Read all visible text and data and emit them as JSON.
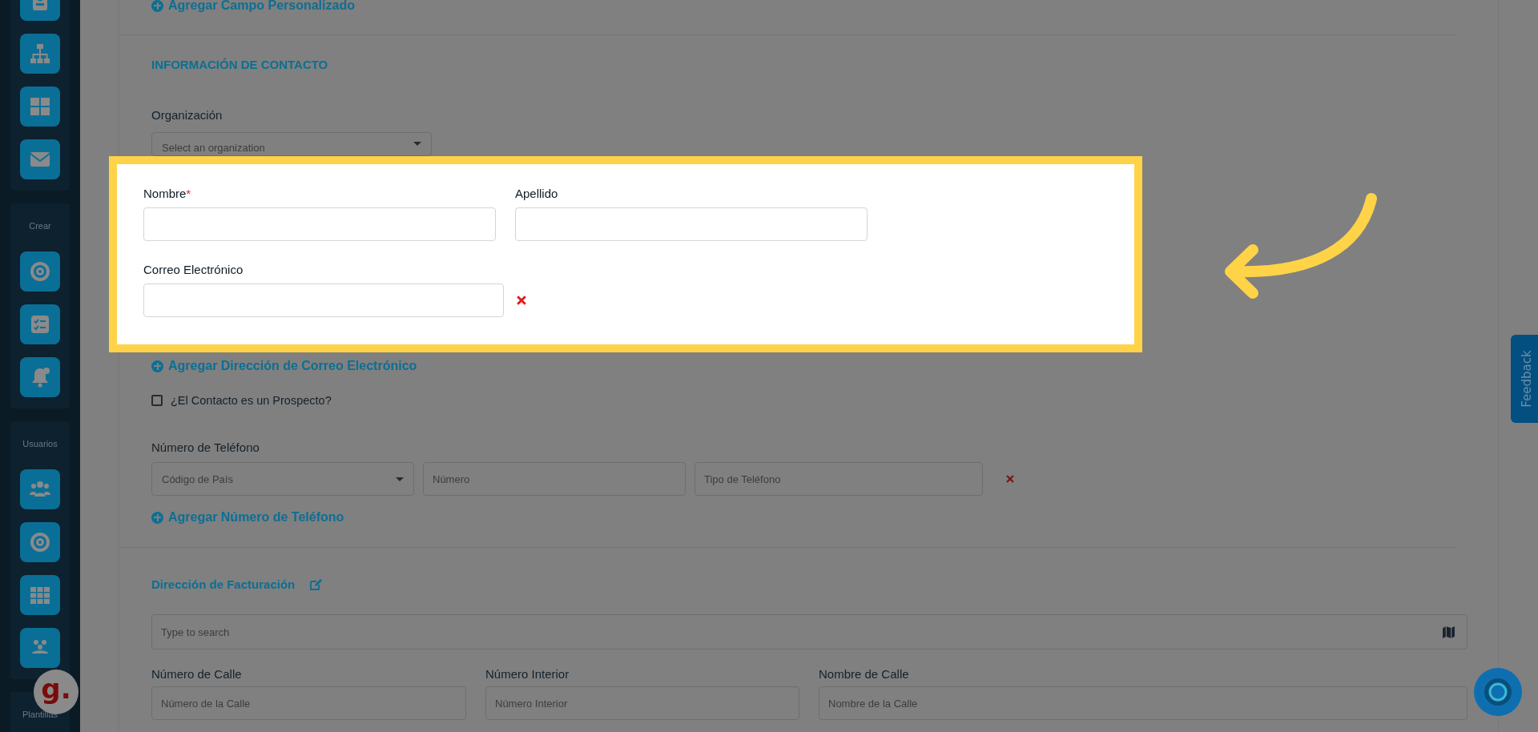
{
  "sidebar": {
    "groups": [
      {
        "items": [
          {
            "kind": "contact"
          },
          {
            "kind": "org-chart"
          },
          {
            "kind": "dashboard"
          },
          {
            "kind": "mail"
          }
        ]
      },
      {
        "label": "Crear",
        "items": [
          {
            "kind": "target"
          },
          {
            "kind": "checklist"
          },
          {
            "kind": "reminder"
          }
        ]
      },
      {
        "label": "Usuarios",
        "items": [
          {
            "kind": "team"
          },
          {
            "kind": "goal"
          },
          {
            "kind": "apps"
          },
          {
            "kind": "groups"
          }
        ]
      },
      {
        "label": "Plantillas"
      }
    ],
    "logo": "g."
  },
  "form": {
    "custom_field_link": "Agregar Campo Personalizado",
    "section_title": "INFORMACIÓN DE CONTACTO",
    "organization": {
      "label": "Organización",
      "placeholder": "Select an organization"
    },
    "highlight": {
      "first_name": {
        "label": "Nombre",
        "required_mark": "*"
      },
      "last_name": {
        "label": "Apellido"
      },
      "email": {
        "label": "Correo Electrónico"
      }
    },
    "add_email_link": "Agregar Dirección de Correo Electrónico",
    "prospect": {
      "label": "¿El Contacto es un Prospecto?",
      "checked": false
    },
    "phone": {
      "label": "Número de Teléfono",
      "country_placeholder": "Código de País",
      "number_placeholder": "Número",
      "type_placeholder": "Tipo de Teléfono"
    },
    "add_phone_link": "Agregar Número de Teléfono",
    "billing": {
      "title": "Dirección de Facturación",
      "search_placeholder": "Type to search",
      "fields": [
        {
          "label": "Número de Calle",
          "placeholder": "Número de la Calle"
        },
        {
          "label": "Número Interior",
          "placeholder": "Número Interior"
        },
        {
          "label": "Nombre de Calle",
          "placeholder": "Nombre de la Calle"
        }
      ]
    }
  },
  "feedback_tab": "Feedback"
}
